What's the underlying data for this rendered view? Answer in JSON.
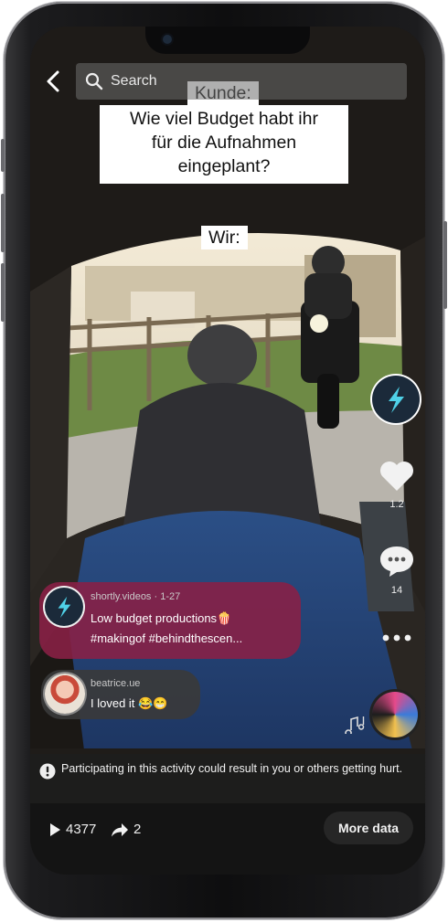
{
  "search": {
    "placeholder": "Search"
  },
  "caption": {
    "top_lines": [
      "Kunde:",
      "Wie viel Budget habt ihr",
      "für die Aufnahmen",
      "eingeplant?"
    ],
    "bottom": "Wir:"
  },
  "rail": {
    "likes": "1.2",
    "comments": "14"
  },
  "post": {
    "author": "shortly.videos",
    "date": "1-27",
    "meta": "shortly.videos · 1-27",
    "line1": "Low budget productions🍿",
    "line2": "#makingof #behindthescen..."
  },
  "comment": {
    "author": "beatrice.ue",
    "text": "I loved it 😂😁"
  },
  "warning": {
    "text": "Participating in this activity could result in you or others getting hurt."
  },
  "stats": {
    "plays": "4377",
    "shares": "2"
  },
  "actions": {
    "more_data": "More data"
  },
  "colors": {
    "post_bubble": "#8a2045",
    "comment_bubble": "#3a3a3a",
    "bolt": "#4fd1e8"
  }
}
